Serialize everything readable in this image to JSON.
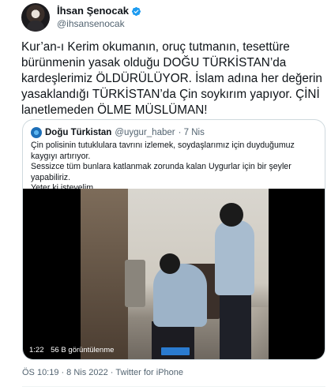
{
  "author": {
    "display_name": "İhsan Şenocak",
    "handle": "@ihsansenocak",
    "verified": true
  },
  "tweet": {
    "text": "Kur’an-ı Kerim okumanın, oruç tutmanın, tesettüre bürünmenin yasak olduğu DOĞU TÜRKİSTAN’da kardeşlerimiz ÖLDÜRÜLÜYOR. İslam adına her değerin yasaklandığı TÜRKİSTAN’da Çin soykırım yapıyor. ÇİNİ lanetlemeden ÖLME MÜSLÜMAN!"
  },
  "quoted": {
    "display_name": "Doğu Türkistan",
    "handle": "@uygur_haber",
    "time": "· 7 Nis",
    "text": "Çin polisinin tutuklulara tavrını izlemek, soydaşlarımız için duyduğumuz kaygıyı artırıyor.\nSessizce tüm bunlara katlanmak zorunda kalan Uygurlar için bir şeyler yapabiliriz.\nYeter ki isteyelim.",
    "video": {
      "duration": "1:22",
      "views": "56 B görüntülenme"
    }
  },
  "footer": {
    "time": "ÖS 10:19",
    "date": "8 Nis 2022",
    "source": "Twitter for iPhone",
    "separator": "·"
  },
  "colors": {
    "text_primary": "#0f1419",
    "text_secondary": "#536471",
    "verified_blue": "#1d9bf0",
    "border": "#cfd9de"
  },
  "icons": {
    "verified": "verified-badge-icon",
    "more": "more-options-icon"
  }
}
